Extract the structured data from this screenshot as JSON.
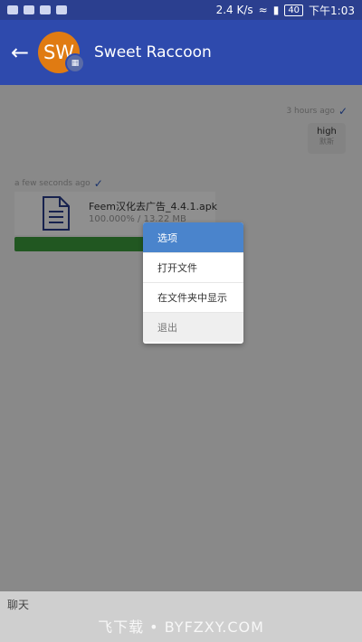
{
  "status_bar": {
    "speed": "2.4 K/s",
    "battery": "40",
    "time": "下午1:03"
  },
  "app_bar": {
    "back_icon": "arrow-left-icon",
    "avatar_initials": "SW",
    "contact_name": "Sweet Raccoon"
  },
  "chat": {
    "messages": [
      {
        "time": "3 hours ago",
        "text": "high",
        "sub": "默斯"
      },
      {
        "time": "a few seconds ago",
        "file_name": "Feem汉化去广告_4.4.1.apk",
        "file_progress": "100.000% / 13.22 MB",
        "progress_fraction": 1.0
      }
    ]
  },
  "context_menu": {
    "header": "选项",
    "items": [
      "打开文件",
      "在文件夹中显示"
    ],
    "exit": "退出"
  },
  "input": {
    "label": "聊天"
  },
  "watermark": "飞下载 • BYFZXY.COM",
  "colors": {
    "appbar": "#2e4aad",
    "menu_header": "#4a84cc",
    "progress": "#3b9b3b",
    "avatar": "#e07b12"
  }
}
